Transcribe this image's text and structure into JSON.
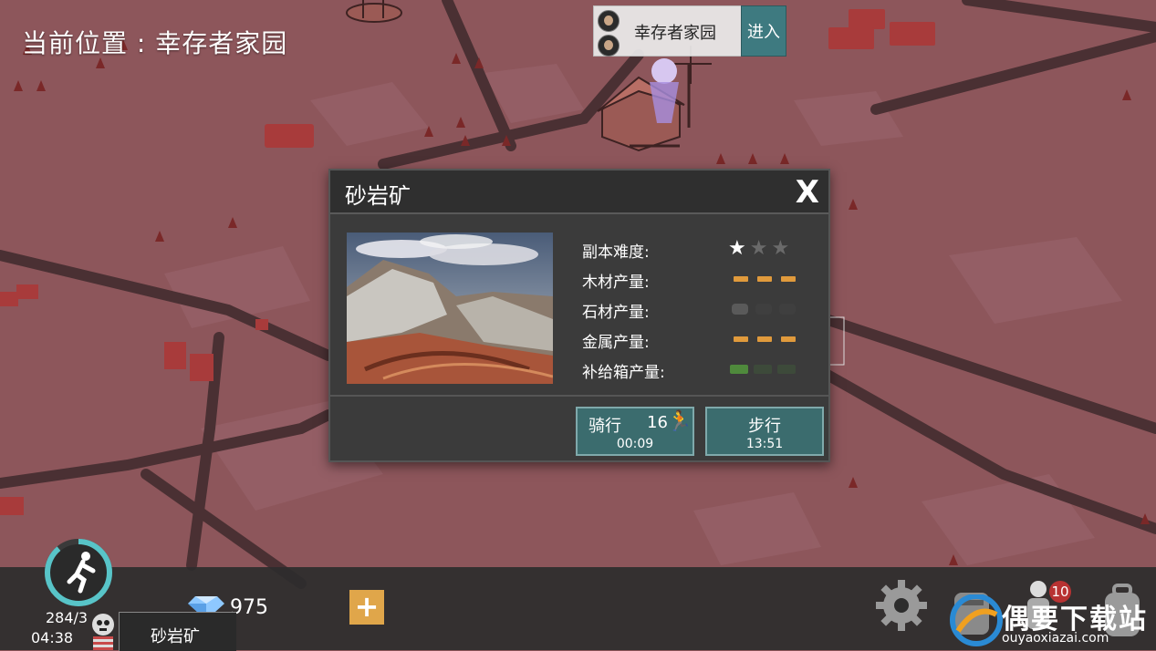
{
  "location": {
    "prefix": "当前位置",
    "separator": ":",
    "name": "幸存者家园"
  },
  "home_marker": {
    "name": "幸存者家园",
    "enter_label": "进入"
  },
  "dialog": {
    "title": "砂岩矿",
    "close_label": "X",
    "stats": [
      {
        "label": "副本难度:",
        "kind": "stars",
        "level": 1,
        "max": 3
      },
      {
        "label": "木材产量:",
        "kind": "bars",
        "level": 3,
        "max": 3,
        "color": "#e09a3c"
      },
      {
        "label": "石材产量:",
        "kind": "rocks",
        "level": 1,
        "max": 3,
        "color": "#5a5a5a"
      },
      {
        "label": "金属产量:",
        "kind": "bars",
        "level": 3,
        "max": 3,
        "color": "#e09a3c"
      },
      {
        "label": "补给箱产量:",
        "kind": "crates",
        "level": 1,
        "max": 3,
        "color": "#4f8a3c"
      }
    ],
    "ride": {
      "label": "骑行",
      "count": "16",
      "time": "00:09"
    },
    "walk": {
      "label": "步行",
      "time": "13:51"
    }
  },
  "hud": {
    "stamina": "284/3",
    "time": "04:38",
    "gems": "975",
    "current_location": "砂岩矿",
    "notification_count": "10"
  },
  "watermark": {
    "text": "偶要下载站",
    "url": "ouyaoxiazai.com"
  }
}
